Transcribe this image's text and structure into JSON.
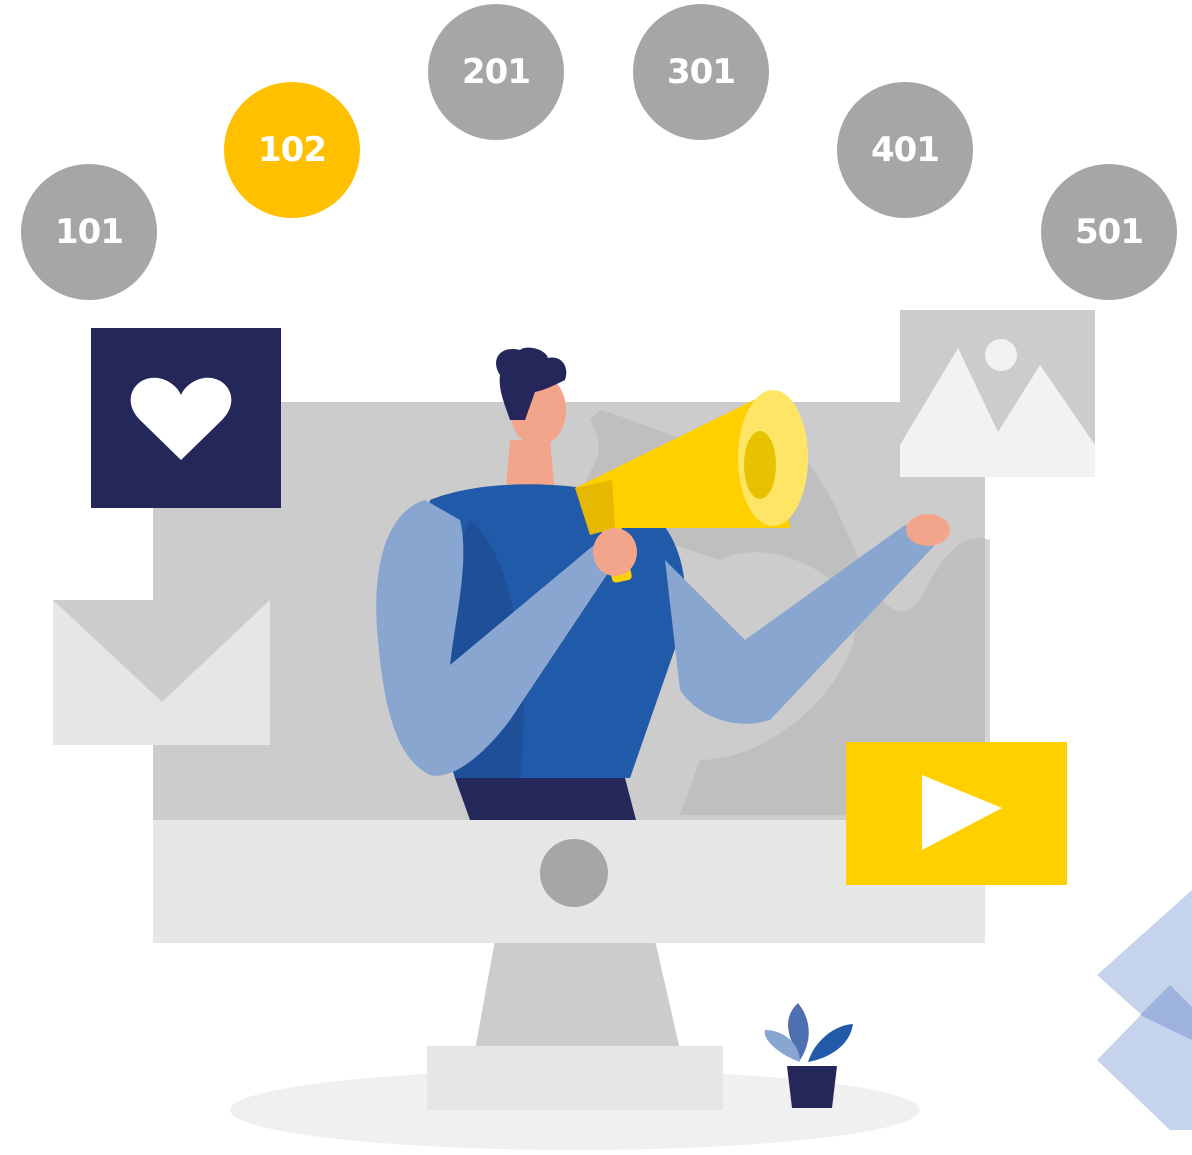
{
  "badges": [
    {
      "label": "101",
      "color": "#a6a6a6"
    },
    {
      "label": "102",
      "color": "#ffc000"
    },
    {
      "label": "201",
      "color": "#a6a6a6"
    },
    {
      "label": "301",
      "color": "#a6a6a6"
    },
    {
      "label": "401",
      "color": "#a6a6a6"
    },
    {
      "label": "501",
      "color": "#a6a6a6"
    }
  ],
  "palette": {
    "navy": "#25265a",
    "blue": "#215aa8",
    "light_blue": "#88a6cf",
    "yellow": "#ffd000",
    "gray_light": "#e6e6e6",
    "gray_mid": "#cccccc",
    "skin": "#f2a58a"
  },
  "icons": [
    "heart-icon",
    "mail-icon",
    "image-icon",
    "play-icon",
    "megaphone-icon",
    "plant-icon"
  ]
}
